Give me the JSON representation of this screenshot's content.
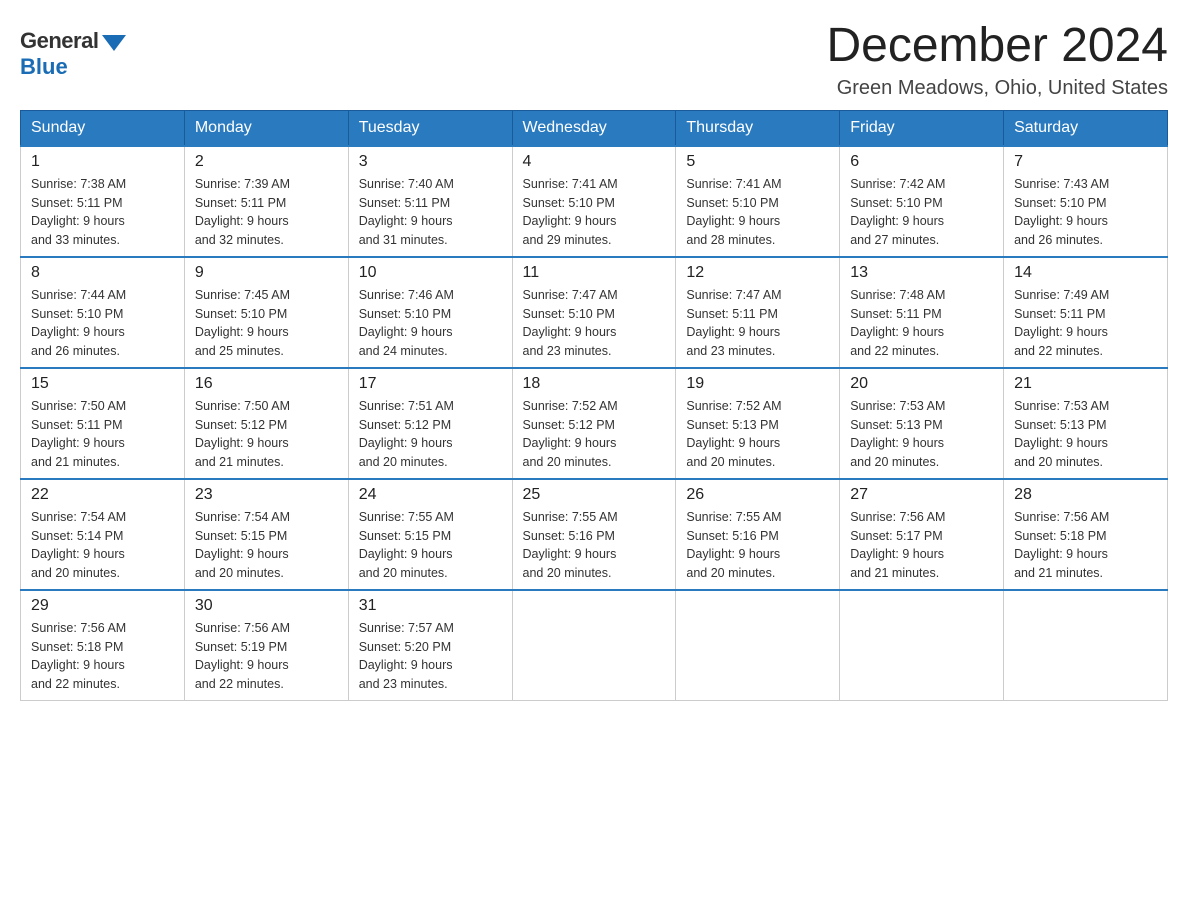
{
  "logo": {
    "general": "General",
    "blue": "Blue"
  },
  "title": "December 2024",
  "location": "Green Meadows, Ohio, United States",
  "days_of_week": [
    "Sunday",
    "Monday",
    "Tuesday",
    "Wednesday",
    "Thursday",
    "Friday",
    "Saturday"
  ],
  "weeks": [
    [
      {
        "day": "1",
        "sunrise": "7:38 AM",
        "sunset": "5:11 PM",
        "daylight": "9 hours and 33 minutes."
      },
      {
        "day": "2",
        "sunrise": "7:39 AM",
        "sunset": "5:11 PM",
        "daylight": "9 hours and 32 minutes."
      },
      {
        "day": "3",
        "sunrise": "7:40 AM",
        "sunset": "5:11 PM",
        "daylight": "9 hours and 31 minutes."
      },
      {
        "day": "4",
        "sunrise": "7:41 AM",
        "sunset": "5:10 PM",
        "daylight": "9 hours and 29 minutes."
      },
      {
        "day": "5",
        "sunrise": "7:41 AM",
        "sunset": "5:10 PM",
        "daylight": "9 hours and 28 minutes."
      },
      {
        "day": "6",
        "sunrise": "7:42 AM",
        "sunset": "5:10 PM",
        "daylight": "9 hours and 27 minutes."
      },
      {
        "day": "7",
        "sunrise": "7:43 AM",
        "sunset": "5:10 PM",
        "daylight": "9 hours and 26 minutes."
      }
    ],
    [
      {
        "day": "8",
        "sunrise": "7:44 AM",
        "sunset": "5:10 PM",
        "daylight": "9 hours and 26 minutes."
      },
      {
        "day": "9",
        "sunrise": "7:45 AM",
        "sunset": "5:10 PM",
        "daylight": "9 hours and 25 minutes."
      },
      {
        "day": "10",
        "sunrise": "7:46 AM",
        "sunset": "5:10 PM",
        "daylight": "9 hours and 24 minutes."
      },
      {
        "day": "11",
        "sunrise": "7:47 AM",
        "sunset": "5:10 PM",
        "daylight": "9 hours and 23 minutes."
      },
      {
        "day": "12",
        "sunrise": "7:47 AM",
        "sunset": "5:11 PM",
        "daylight": "9 hours and 23 minutes."
      },
      {
        "day": "13",
        "sunrise": "7:48 AM",
        "sunset": "5:11 PM",
        "daylight": "9 hours and 22 minutes."
      },
      {
        "day": "14",
        "sunrise": "7:49 AM",
        "sunset": "5:11 PM",
        "daylight": "9 hours and 22 minutes."
      }
    ],
    [
      {
        "day": "15",
        "sunrise": "7:50 AM",
        "sunset": "5:11 PM",
        "daylight": "9 hours and 21 minutes."
      },
      {
        "day": "16",
        "sunrise": "7:50 AM",
        "sunset": "5:12 PM",
        "daylight": "9 hours and 21 minutes."
      },
      {
        "day": "17",
        "sunrise": "7:51 AM",
        "sunset": "5:12 PM",
        "daylight": "9 hours and 20 minutes."
      },
      {
        "day": "18",
        "sunrise": "7:52 AM",
        "sunset": "5:12 PM",
        "daylight": "9 hours and 20 minutes."
      },
      {
        "day": "19",
        "sunrise": "7:52 AM",
        "sunset": "5:13 PM",
        "daylight": "9 hours and 20 minutes."
      },
      {
        "day": "20",
        "sunrise": "7:53 AM",
        "sunset": "5:13 PM",
        "daylight": "9 hours and 20 minutes."
      },
      {
        "day": "21",
        "sunrise": "7:53 AM",
        "sunset": "5:13 PM",
        "daylight": "9 hours and 20 minutes."
      }
    ],
    [
      {
        "day": "22",
        "sunrise": "7:54 AM",
        "sunset": "5:14 PM",
        "daylight": "9 hours and 20 minutes."
      },
      {
        "day": "23",
        "sunrise": "7:54 AM",
        "sunset": "5:15 PM",
        "daylight": "9 hours and 20 minutes."
      },
      {
        "day": "24",
        "sunrise": "7:55 AM",
        "sunset": "5:15 PM",
        "daylight": "9 hours and 20 minutes."
      },
      {
        "day": "25",
        "sunrise": "7:55 AM",
        "sunset": "5:16 PM",
        "daylight": "9 hours and 20 minutes."
      },
      {
        "day": "26",
        "sunrise": "7:55 AM",
        "sunset": "5:16 PM",
        "daylight": "9 hours and 20 minutes."
      },
      {
        "day": "27",
        "sunrise": "7:56 AM",
        "sunset": "5:17 PM",
        "daylight": "9 hours and 21 minutes."
      },
      {
        "day": "28",
        "sunrise": "7:56 AM",
        "sunset": "5:18 PM",
        "daylight": "9 hours and 21 minutes."
      }
    ],
    [
      {
        "day": "29",
        "sunrise": "7:56 AM",
        "sunset": "5:18 PM",
        "daylight": "9 hours and 22 minutes."
      },
      {
        "day": "30",
        "sunrise": "7:56 AM",
        "sunset": "5:19 PM",
        "daylight": "9 hours and 22 minutes."
      },
      {
        "day": "31",
        "sunrise": "7:57 AM",
        "sunset": "5:20 PM",
        "daylight": "9 hours and 23 minutes."
      },
      null,
      null,
      null,
      null
    ]
  ],
  "labels": {
    "sunrise": "Sunrise:",
    "sunset": "Sunset:",
    "daylight": "Daylight:"
  }
}
